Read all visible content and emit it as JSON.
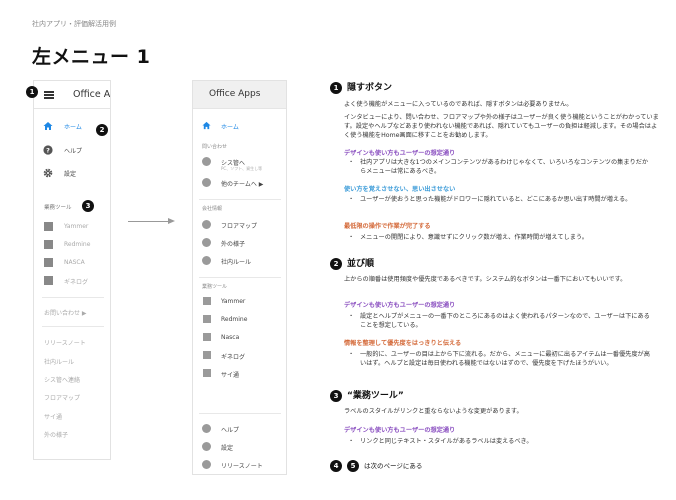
{
  "breadcrumb": "社内アプリ・評価解活用例",
  "title": "左メニュー 1",
  "left_panel": {
    "app_title": "Office Ap",
    "items": [
      {
        "label": "ホーム",
        "icon": "home-icon"
      },
      {
        "label": "ヘルプ",
        "icon": "help-icon"
      },
      {
        "label": "設定",
        "icon": "gear-icon"
      }
    ],
    "tools_label": "業務ツール",
    "tools": [
      "Yammer",
      "Redmine",
      "NASCA",
      "ギネログ"
    ],
    "inquiry": "お問い合わせ ▶",
    "links": [
      "リリースノート",
      "社内ルール",
      "シス管へ連絡",
      "フロアマップ",
      "サイ通",
      "外の様子"
    ]
  },
  "right_panel": {
    "app_title": "Office Apps",
    "home": "ホーム",
    "section_inquiry": "問い合わせ",
    "sys_contact": "シス管へ",
    "sys_contact_sub": "PC、ソフト、資生し等",
    "other_team": "他のチームへ ▶",
    "section_company": "会社情報",
    "company_items": [
      "フロアマップ",
      "外の様子",
      "社内ルール"
    ],
    "section_tools": "業務ツール",
    "tools": [
      "Yammer",
      "Redmine",
      "Nasca",
      "ギネログ",
      "サイ通"
    ],
    "bottom": [
      "ヘルプ",
      "設定",
      "リリースノート"
    ]
  },
  "badges": {
    "b1": "1",
    "b2": "2",
    "b3": "3",
    "b4": "4",
    "b5": "5"
  },
  "sections": {
    "s1": {
      "heading": "隠すボタン",
      "p1": "よく使う機能がメニューに入っているのであれば、隠すボタンは必要ありません。",
      "p2": "インタビューにより、問い合わせ、フロアマップや外の様子はユーザーが良く使う機能ということがわかっています。設定やヘルプなどあまり使われない機能であれば、隠れていてもユーザーの負担は軽減します。その場合はよく使う機能をHome画面に移すことをお勧めします。",
      "sub1": "デザインも使い方もユーザーの想定通り",
      "li1": "社内アプリは大きな1つのメインコンテンツがあるわけじゃなくて、いろいろなコンテンツの集まりだからメニューは常にあるべき。",
      "sub2": "使い方を覚えさせない、思い出させない",
      "li2": "ユーザーが使おうと思った機能がドロワーに隠れていると、どこにあるか思い出す時間が増える。",
      "sub3": "最低限の操作で作業が完了する",
      "li3": "メニューの開閉により、意識せずにクリック数が増え、作業時間が増えてしまう。"
    },
    "s2": {
      "heading": "並び順",
      "p1": "上からの順番は使用頻度や優先度であるべきです。システム的なボタンは一番下においてもいいです。",
      "sub1": "デザインも使い方もユーザーの想定通り",
      "li1": "設定とヘルプがメニューの一番下のところにあるのはよく使われるパターンなので、ユーザーは下にあることを想定している。",
      "sub2": "情報を整理して優先度をはっきりと伝える",
      "li2": "一般的に、ユーザーの目は上から下に流れる。だから、メニューに最初に出るアイテムは一番優先度が高いはず。ヘルプと設定は毎日使われる機能ではないはずので、優先度を下げたほうがいい。"
    },
    "s3": {
      "heading": "“業務ツール”",
      "p1": "ラベルのスタイルがリンクと重ならないような変更があります。",
      "sub1": "デザインも使い方もユーザーの想定通り",
      "li1": "リンクと同じテキスト・スタイルがあるラベルは変えるべき。"
    },
    "footer_note": "は次のページにある"
  },
  "colors": {
    "accent_blue": "#1e88e5",
    "purple": "#8a4fc0",
    "blue": "#3b9bd8",
    "orange": "#d46a3a"
  }
}
